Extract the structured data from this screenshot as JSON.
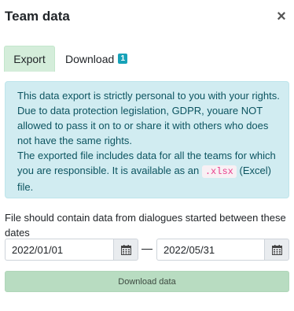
{
  "dialog": {
    "title": "Team data",
    "close_symbol": "×"
  },
  "tabs": [
    {
      "label": "Export",
      "active": true
    },
    {
      "label": "Download",
      "badge": "1",
      "active": false
    }
  ],
  "alert": {
    "paragraph1": "This data export is strictly personal to you with your rights. Due to data protection legislation, GDPR, youare NOT allowed to pass it on to or share it with others who does not have the same rights.",
    "paragraph2_before": "The exported file includes data for all the teams for which you are responsible. It is available as an ",
    "paragraph2_code": ".xlsx",
    "paragraph2_after": " (Excel) file."
  },
  "range": {
    "label": "File should contain data from dialogues started between these dates",
    "start_date": "2022/01/01",
    "end_date": "2022/05/31",
    "separator": "—",
    "calendar_icon": "calendar-icon"
  },
  "actions": {
    "download_label": "Download data"
  },
  "colors": {
    "tab_active_bg": "#d4edda",
    "badge": "#17a2b8",
    "alert_bg": "#d1ecf1",
    "alert_text": "#0c5460",
    "code_text": "#e83e8c",
    "button_bg": "#b8dcc1"
  }
}
